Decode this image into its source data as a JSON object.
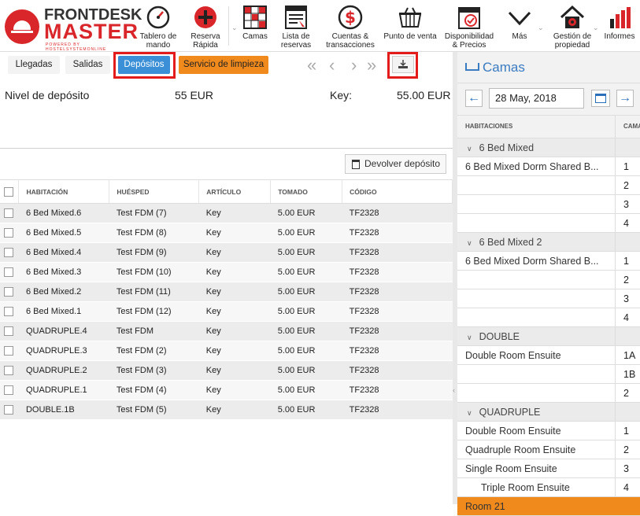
{
  "logo": {
    "line1": "FRONTDESK",
    "line2": "MASTER",
    "tagline": "POWERED BY HOSTELSYSTEMONLINE"
  },
  "toolbar": {
    "items": [
      {
        "label": "Tablero de mando",
        "icon": "dashboard-gauge-icon"
      },
      {
        "label": "Reserva Rápida",
        "icon": "plus-circle-icon"
      },
      {
        "label": "Camas",
        "icon": "bed-grid-icon"
      },
      {
        "label": "Lista de reservas",
        "icon": "list-icon"
      },
      {
        "label": "Cuentas & transacciones",
        "icon": "dollar-circle-icon"
      },
      {
        "label": "Punto de venta",
        "icon": "basket-icon"
      },
      {
        "label": "Disponibilidad & Precios",
        "icon": "calendar-check-icon"
      },
      {
        "label": "Más",
        "icon": "chevron-down-icon"
      },
      {
        "label": "Gestión de propiedad",
        "icon": "house-gear-icon"
      },
      {
        "label": "Informes",
        "icon": "bar-chart-icon"
      }
    ]
  },
  "tabs": {
    "arrivals": "Llegadas",
    "departures": "Salidas",
    "deposits": "Depósitos",
    "housekeeping": "Servicio de limpieza"
  },
  "deposit_info": {
    "level_label": "Nivel de depósito",
    "level_value": "55 EUR",
    "key_label": "Key:",
    "key_value": "55.00 EUR"
  },
  "return_button": "Devolver depósito",
  "table": {
    "headers": [
      "HABITACIÓN",
      "HUÉSPED",
      "ARTÍCULO",
      "TOMADO",
      "CÓDIGO"
    ],
    "rows": [
      [
        "6 Bed Mixed.6",
        "Test FDM (7)",
        "Key",
        "5.00 EUR",
        "TF2328"
      ],
      [
        "6 Bed Mixed.5",
        "Test FDM (8)",
        "Key",
        "5.00 EUR",
        "TF2328"
      ],
      [
        "6 Bed Mixed.4",
        "Test FDM (9)",
        "Key",
        "5.00 EUR",
        "TF2328"
      ],
      [
        "6 Bed Mixed.3",
        "Test FDM (10)",
        "Key",
        "5.00 EUR",
        "TF2328"
      ],
      [
        "6 Bed Mixed.2",
        "Test FDM (11)",
        "Key",
        "5.00 EUR",
        "TF2328"
      ],
      [
        "6 Bed Mixed.1",
        "Test FDM (12)",
        "Key",
        "5.00 EUR",
        "TF2328"
      ],
      [
        "QUADRUPLE.4",
        "Test FDM",
        "Key",
        "5.00 EUR",
        "TF2328"
      ],
      [
        "QUADRUPLE.3",
        "Test FDM (2)",
        "Key",
        "5.00 EUR",
        "TF2328"
      ],
      [
        "QUADRUPLE.2",
        "Test FDM (3)",
        "Key",
        "5.00 EUR",
        "TF2328"
      ],
      [
        "QUADRUPLE.1",
        "Test FDM (4)",
        "Key",
        "5.00 EUR",
        "TF2328"
      ],
      [
        "DOUBLE.1B",
        "Test FDM (5)",
        "Key",
        "5.00 EUR",
        "TF2328"
      ]
    ]
  },
  "beds_panel": {
    "title": "Camas",
    "date": "28 May, 2018",
    "col1": "HABITACIONES",
    "col2": "CAMA",
    "rows": [
      {
        "type": "group",
        "name": "6 Bed Mixed",
        "bed": ""
      },
      {
        "type": "room",
        "name": "6 Bed Mixed Dorm Shared B...",
        "bed": "1"
      },
      {
        "type": "room",
        "name": "",
        "bed": "2"
      },
      {
        "type": "room",
        "name": "",
        "bed": "3"
      },
      {
        "type": "room",
        "name": "",
        "bed": "4"
      },
      {
        "type": "group",
        "name": "6 Bed Mixed 2",
        "bed": ""
      },
      {
        "type": "room",
        "name": "6 Bed Mixed Dorm Shared B...",
        "bed": "1"
      },
      {
        "type": "room",
        "name": "",
        "bed": "2"
      },
      {
        "type": "room",
        "name": "",
        "bed": "3"
      },
      {
        "type": "room",
        "name": "",
        "bed": "4"
      },
      {
        "type": "group",
        "name": "DOUBLE",
        "bed": ""
      },
      {
        "type": "room",
        "name": "Double Room Ensuite",
        "bed": "1A"
      },
      {
        "type": "room",
        "name": "",
        "bed": "1B"
      },
      {
        "type": "room",
        "name": "",
        "bed": "2"
      },
      {
        "type": "group",
        "name": "QUADRUPLE",
        "bed": ""
      },
      {
        "type": "room",
        "name": "Double Room Ensuite",
        "bed": "1"
      },
      {
        "type": "room",
        "name": "Quadruple Room Ensuite",
        "bed": "2"
      },
      {
        "type": "room",
        "name": "Single Room Ensuite",
        "bed": "3"
      },
      {
        "type": "sub",
        "name": "Triple Room Ensuite",
        "bed": "4"
      },
      {
        "type": "orange",
        "name": "Room 21",
        "bed": ""
      }
    ]
  },
  "colors": {
    "accent": "#3a8fd6",
    "brand_red": "#d9262b",
    "orange": "#f08a1c",
    "highlight_frame": "#e31b1b"
  }
}
